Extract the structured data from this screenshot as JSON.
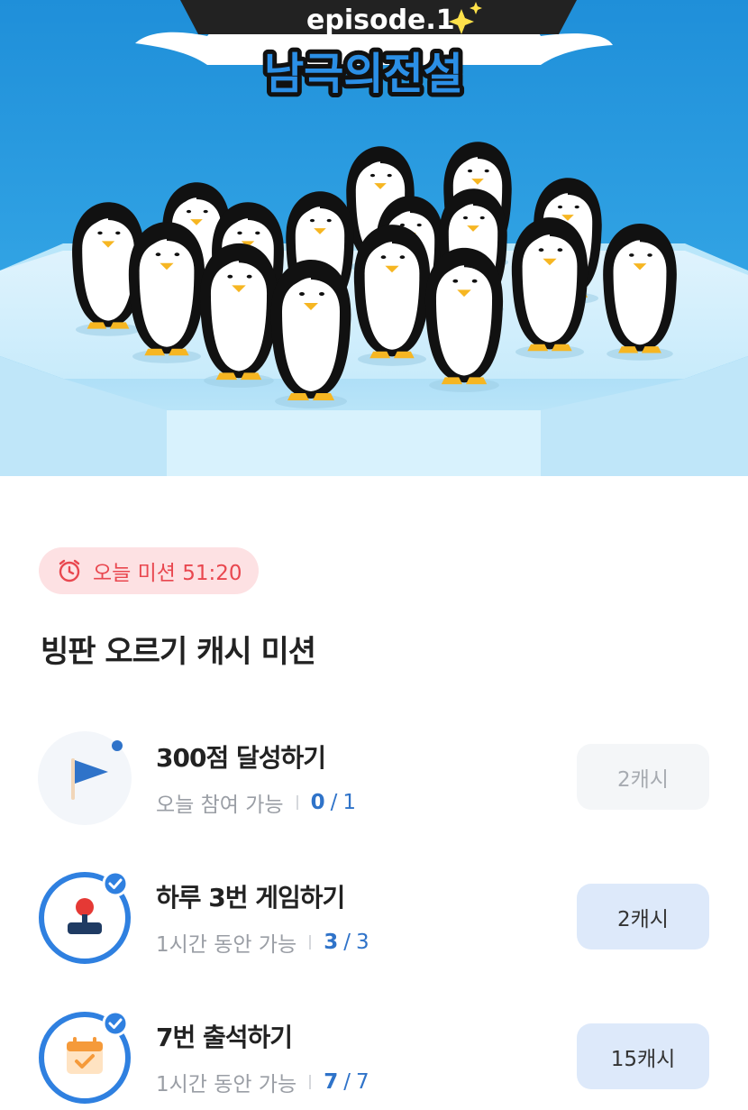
{
  "hero": {
    "episode": "episode.1",
    "title": "남극의전설"
  },
  "timer": {
    "label": "오늘 미션 51:20",
    "color": "#e9474f"
  },
  "section_title": "빙판 오르기 캐시 미션",
  "missions": [
    {
      "title": "300점 달성하기",
      "availability": "오늘 참여 가능",
      "done": "0",
      "slash": "/",
      "total": "1",
      "reward": "2캐시",
      "icon": "flag-icon"
    },
    {
      "title": "하루 3번 게임하기",
      "availability": "1시간 동안 가능",
      "done": "3",
      "slash": "/",
      "total": "3",
      "reward": "2캐시",
      "icon": "game-joystick-icon"
    },
    {
      "title": "7번 출석하기",
      "availability": "1시간 동안 가능",
      "done": "7",
      "slash": "/",
      "total": "7",
      "reward": "15캐시",
      "icon": "calendar-check-icon"
    }
  ],
  "colors": {
    "accent": "#2f73c9",
    "sky": "#2aa3e4",
    "timer_bg": "#fde1e3"
  }
}
